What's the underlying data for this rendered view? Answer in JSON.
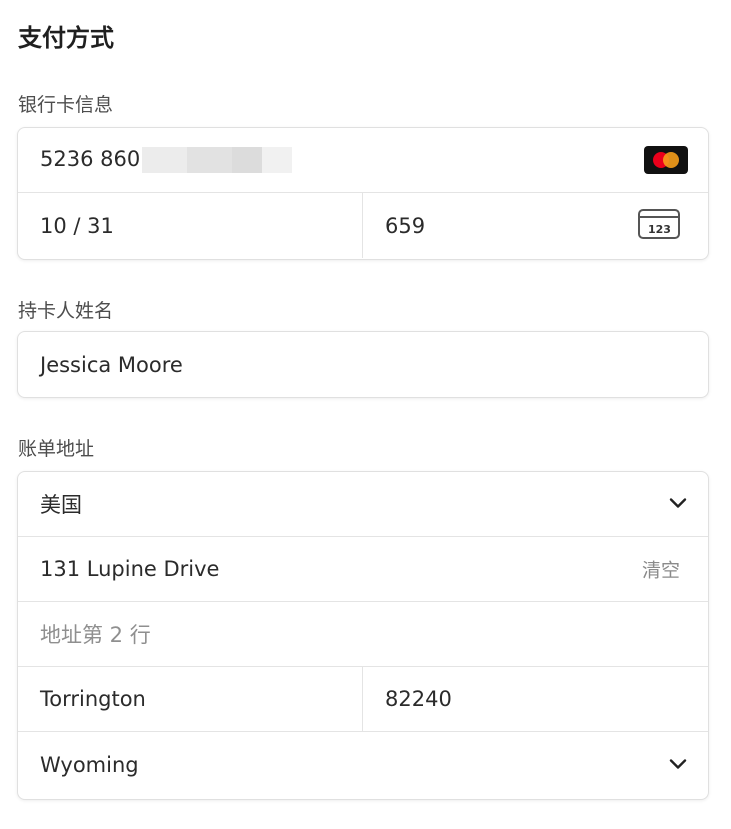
{
  "title": "支付方式",
  "card_section": {
    "label": "银行卡信息",
    "card_number": "5236 860",
    "expiry": "10 / 31",
    "cvc": "659",
    "cvc_icon_text": "123"
  },
  "name_section": {
    "label": "持卡人姓名",
    "name": "Jessica Moore"
  },
  "address_section": {
    "label": "账单地址",
    "country": "美国",
    "line1": "131 Lupine Drive",
    "clear_label": "清空",
    "line2_placeholder": "地址第 2 行",
    "city": "Torrington",
    "zip": "82240",
    "state": "Wyoming"
  },
  "icons": {
    "card_brand": "mastercard-icon",
    "cvc": "card-cvc-icon",
    "dropdown": "chevron-down-icon"
  },
  "colors": {
    "mastercard_red": "#eb001b",
    "mastercard_orange": "#f79e1b"
  }
}
